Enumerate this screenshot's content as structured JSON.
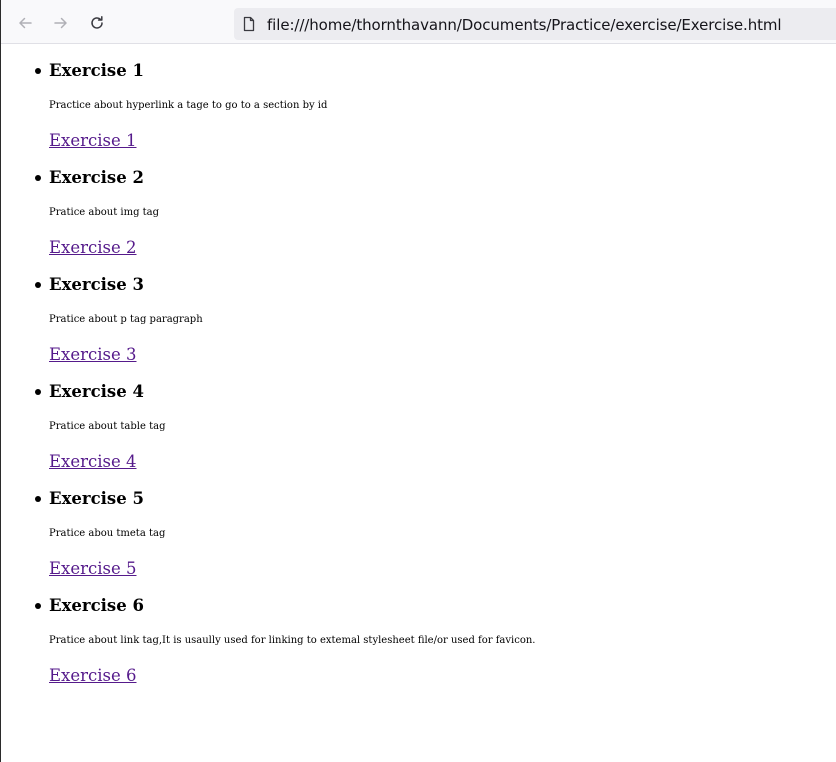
{
  "browser": {
    "url": "file:///home/thornthavann/Documents/Practice/exercise/Exercise.html",
    "icons": {
      "back": "arrow-left-icon",
      "forward": "arrow-right-icon",
      "reload": "reload-icon",
      "page": "page-icon"
    }
  },
  "colors": {
    "visited_link": "#551a8b",
    "text": "#000000",
    "urlbar_bg": "#ececf0",
    "toolbar_bg": "#f9f9fb"
  },
  "exercises": [
    {
      "title": "Exercise 1",
      "description": "Practice about hyperlink a tage to go to a section by id",
      "link": "Exercise 1"
    },
    {
      "title": "Exercise 2",
      "description": "Pratice about img tag",
      "link": "Exercise 2"
    },
    {
      "title": "Exercise 3",
      "description": "Pratice about p tag paragraph",
      "link": "Exercise 3"
    },
    {
      "title": "Exercise 4",
      "description": "Pratice about table tag",
      "link": "Exercise 4"
    },
    {
      "title": "Exercise 5",
      "description": "Pratice abou tmeta tag",
      "link": "Exercise 5"
    },
    {
      "title": "Exercise 6",
      "description": "Pratice about link tag,It is usaully used for linking to extemal stylesheet file/or used for favicon.",
      "link": "Exercise 6"
    }
  ]
}
